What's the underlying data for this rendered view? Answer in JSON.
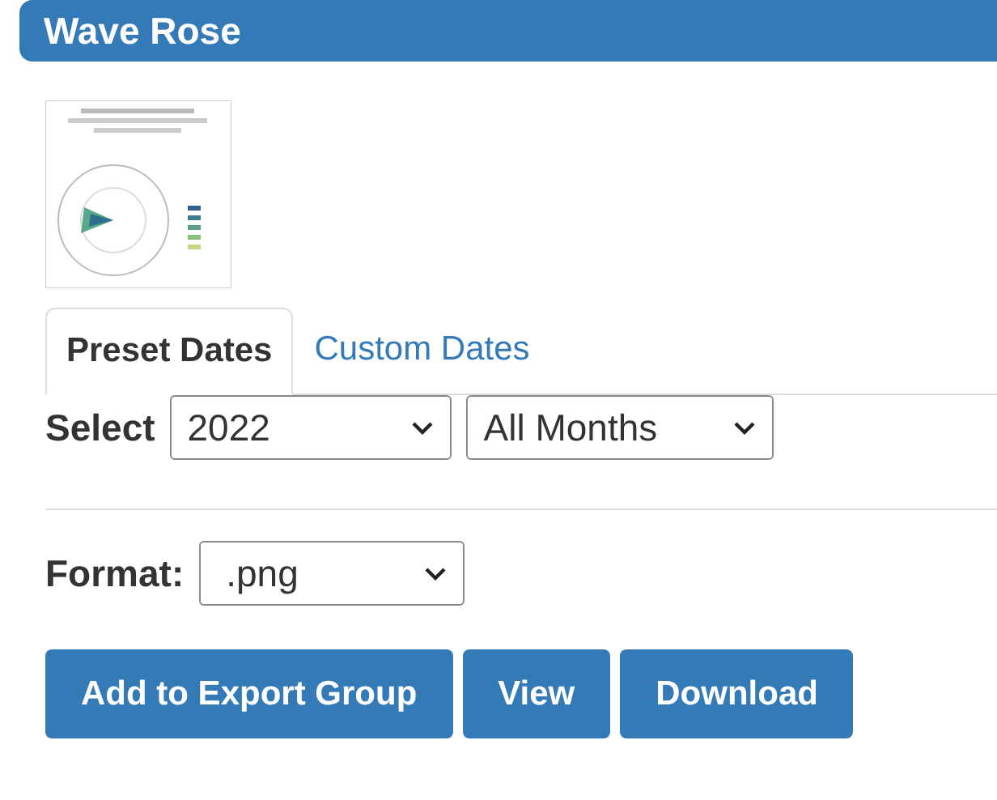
{
  "header": {
    "title": "Wave Rose"
  },
  "tabs": [
    {
      "label": "Preset Dates",
      "selected": true
    },
    {
      "label": "Custom Dates",
      "selected": false
    }
  ],
  "select_row": {
    "label": "Select",
    "dropdowns": [
      {
        "value": "2022"
      },
      {
        "value": "All Months"
      }
    ]
  },
  "format": {
    "label": "Format:",
    "value": ".png"
  },
  "buttons": [
    "Add to Export Group",
    "View",
    "Download"
  ]
}
